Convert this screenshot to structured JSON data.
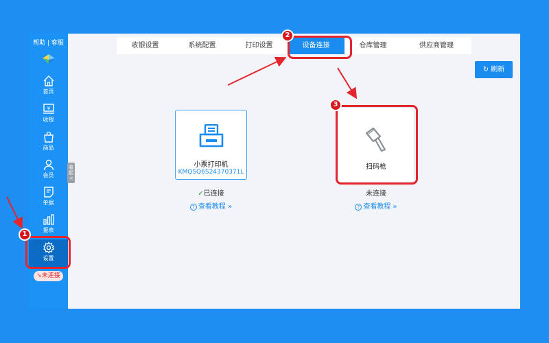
{
  "sidebar": {
    "help": "帮助 | 客服",
    "items": [
      {
        "label": "首页",
        "icon": "home-icon"
      },
      {
        "label": "收银",
        "icon": "cashier-icon"
      },
      {
        "label": "商品",
        "icon": "shopping-bag-icon"
      },
      {
        "label": "会员",
        "icon": "user-icon"
      },
      {
        "label": "单据",
        "icon": "receipt-icon"
      },
      {
        "label": "报表",
        "icon": "bar-chart-icon"
      },
      {
        "label": "设置",
        "icon": "gear-icon"
      }
    ],
    "status": "未连接",
    "collapse": "收起<"
  },
  "tabs": [
    "收银设置",
    "系统配置",
    "打印设置",
    "设备连接",
    "仓库管理",
    "供应商管理"
  ],
  "active_tab": "设备连接",
  "refresh_label": "刷新",
  "devices": [
    {
      "name": "小票打印机",
      "serial": "KMQSQ6S24370371L",
      "state": "已连接",
      "help": "查看教程",
      "icon": "printer-icon"
    },
    {
      "name": "扫码枪",
      "serial": "",
      "state": "未连接",
      "help": "查看教程",
      "icon": "barcode-scanner-icon"
    }
  ],
  "markers": [
    "1",
    "2",
    "3"
  ],
  "colors": {
    "primary": "#1a8cf0",
    "sidebar": "#1b92f5",
    "annotation": "#e3262e",
    "background": "#1f8ef2"
  }
}
